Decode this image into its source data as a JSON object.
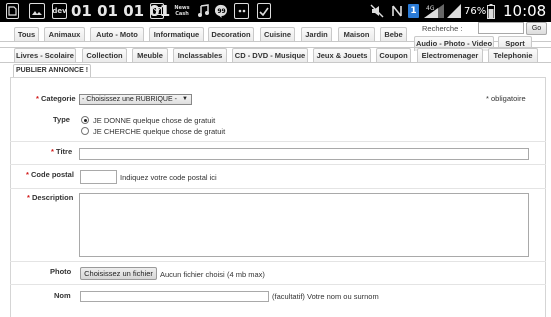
{
  "status_bar": {
    "left_icons": [
      "sim-icon",
      "image-icon",
      "dev-icon",
      "email-icon",
      "news-icon",
      "cash-icon",
      "music-icon",
      "hangouts-icon",
      "chat-icon",
      "check-icon"
    ],
    "binary_text": "01 01 01 01",
    "dev_label": "dev",
    "news_label": "News\nCash",
    "battery_percent": "76%",
    "time": "10:08",
    "sim_number": "1"
  },
  "search": {
    "label": "Recherche :",
    "value": "",
    "go_label": "Go"
  },
  "tabs_row1": [
    "Tous",
    "Animaux",
    "Auto - Moto",
    "Informatique",
    "Decoration",
    "Cuisine",
    "Jardin",
    "Maison",
    "Bebe"
  ],
  "tabs_row2_extra": [
    "Audio - Photo - Video",
    "Sport"
  ],
  "tabs_row3": [
    "Livres - Scolaire",
    "Collection",
    "Meuble",
    "Inclassables",
    "CD - DVD - Musique",
    "Jeux & Jouets",
    "Coupon",
    "Electromenager",
    "Telephonie"
  ],
  "active_tab": "PUBLIER ANNONCE !",
  "form": {
    "category": {
      "star": "*",
      "label": "Categorie",
      "select_value": "- Choisissez une RUBRIQUE -",
      "required_note": "* obligatoire"
    },
    "type": {
      "label": "Type",
      "options": [
        {
          "label": "JE DONNE quelque chose de gratuit",
          "checked": true
        },
        {
          "label": "JE CHERCHE quelque chose de gratuit",
          "checked": false
        }
      ]
    },
    "title": {
      "star": "*",
      "label": "Titre",
      "value": ""
    },
    "postal": {
      "star": "*",
      "label": "Code postal",
      "value": "",
      "hint": "Indiquez votre code postal ici"
    },
    "description": {
      "star": "*",
      "label": "Description",
      "value": ""
    },
    "photo": {
      "label": "Photo",
      "button": "Choisissez un fichier",
      "file_status": "Aucun fichier choisi",
      "limit": "(4 mb max)"
    },
    "name": {
      "label": "Nom",
      "value": "",
      "hint": "(facultatif) Votre nom ou surnom"
    }
  },
  "colors": {
    "required": "#d21a1a",
    "status_bar": "#000000"
  }
}
